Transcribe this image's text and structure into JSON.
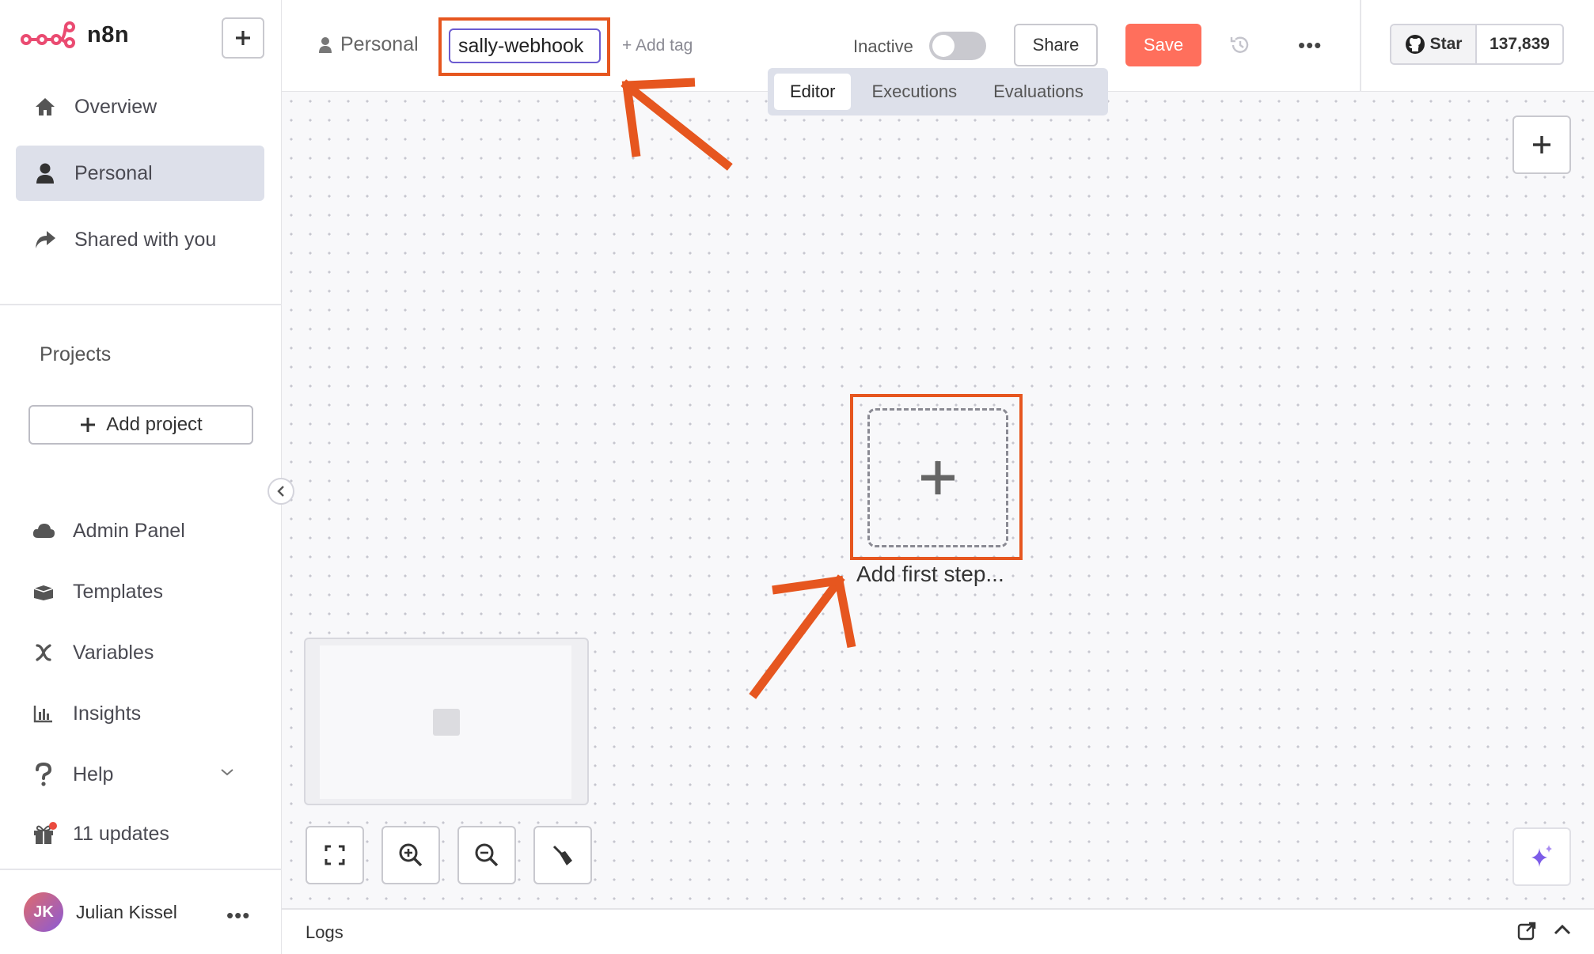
{
  "app": {
    "logo_text": "n8n"
  },
  "sidebar": {
    "items": [
      {
        "label": "Overview",
        "icon": "home-icon"
      },
      {
        "label": "Personal",
        "icon": "user-icon",
        "active": true
      },
      {
        "label": "Shared with you",
        "icon": "share-icon"
      }
    ],
    "projects_title": "Projects",
    "add_project_label": "Add project",
    "bottom_items": [
      {
        "label": "Admin Panel",
        "icon": "cloud-icon"
      },
      {
        "label": "Templates",
        "icon": "box-icon"
      },
      {
        "label": "Variables",
        "icon": "variable-icon"
      },
      {
        "label": "Insights",
        "icon": "chart-icon"
      },
      {
        "label": "Help",
        "icon": "question-icon"
      },
      {
        "label": "11 updates",
        "icon": "gift-icon"
      }
    ],
    "user": {
      "initials": "JK",
      "name": "Julian Kissel"
    }
  },
  "header": {
    "breadcrumb_project": "Personal",
    "workflow_name": "sally-webhook",
    "add_tag": "+ Add tag",
    "inactive_label": "Inactive",
    "share_label": "Share",
    "save_label": "Save",
    "more_label": "•••",
    "github": {
      "star_label": "Star",
      "count": "137,839"
    }
  },
  "tabs": [
    {
      "label": "Editor",
      "active": true
    },
    {
      "label": "Executions"
    },
    {
      "label": "Evaluations"
    }
  ],
  "canvas": {
    "first_step_label": "Add first step..."
  },
  "logs": {
    "label": "Logs"
  },
  "colors": {
    "accent": "#6b5bd1",
    "save": "#ff6f5c",
    "annotation": "#e6561f",
    "active_bg": "#dde0ea"
  }
}
